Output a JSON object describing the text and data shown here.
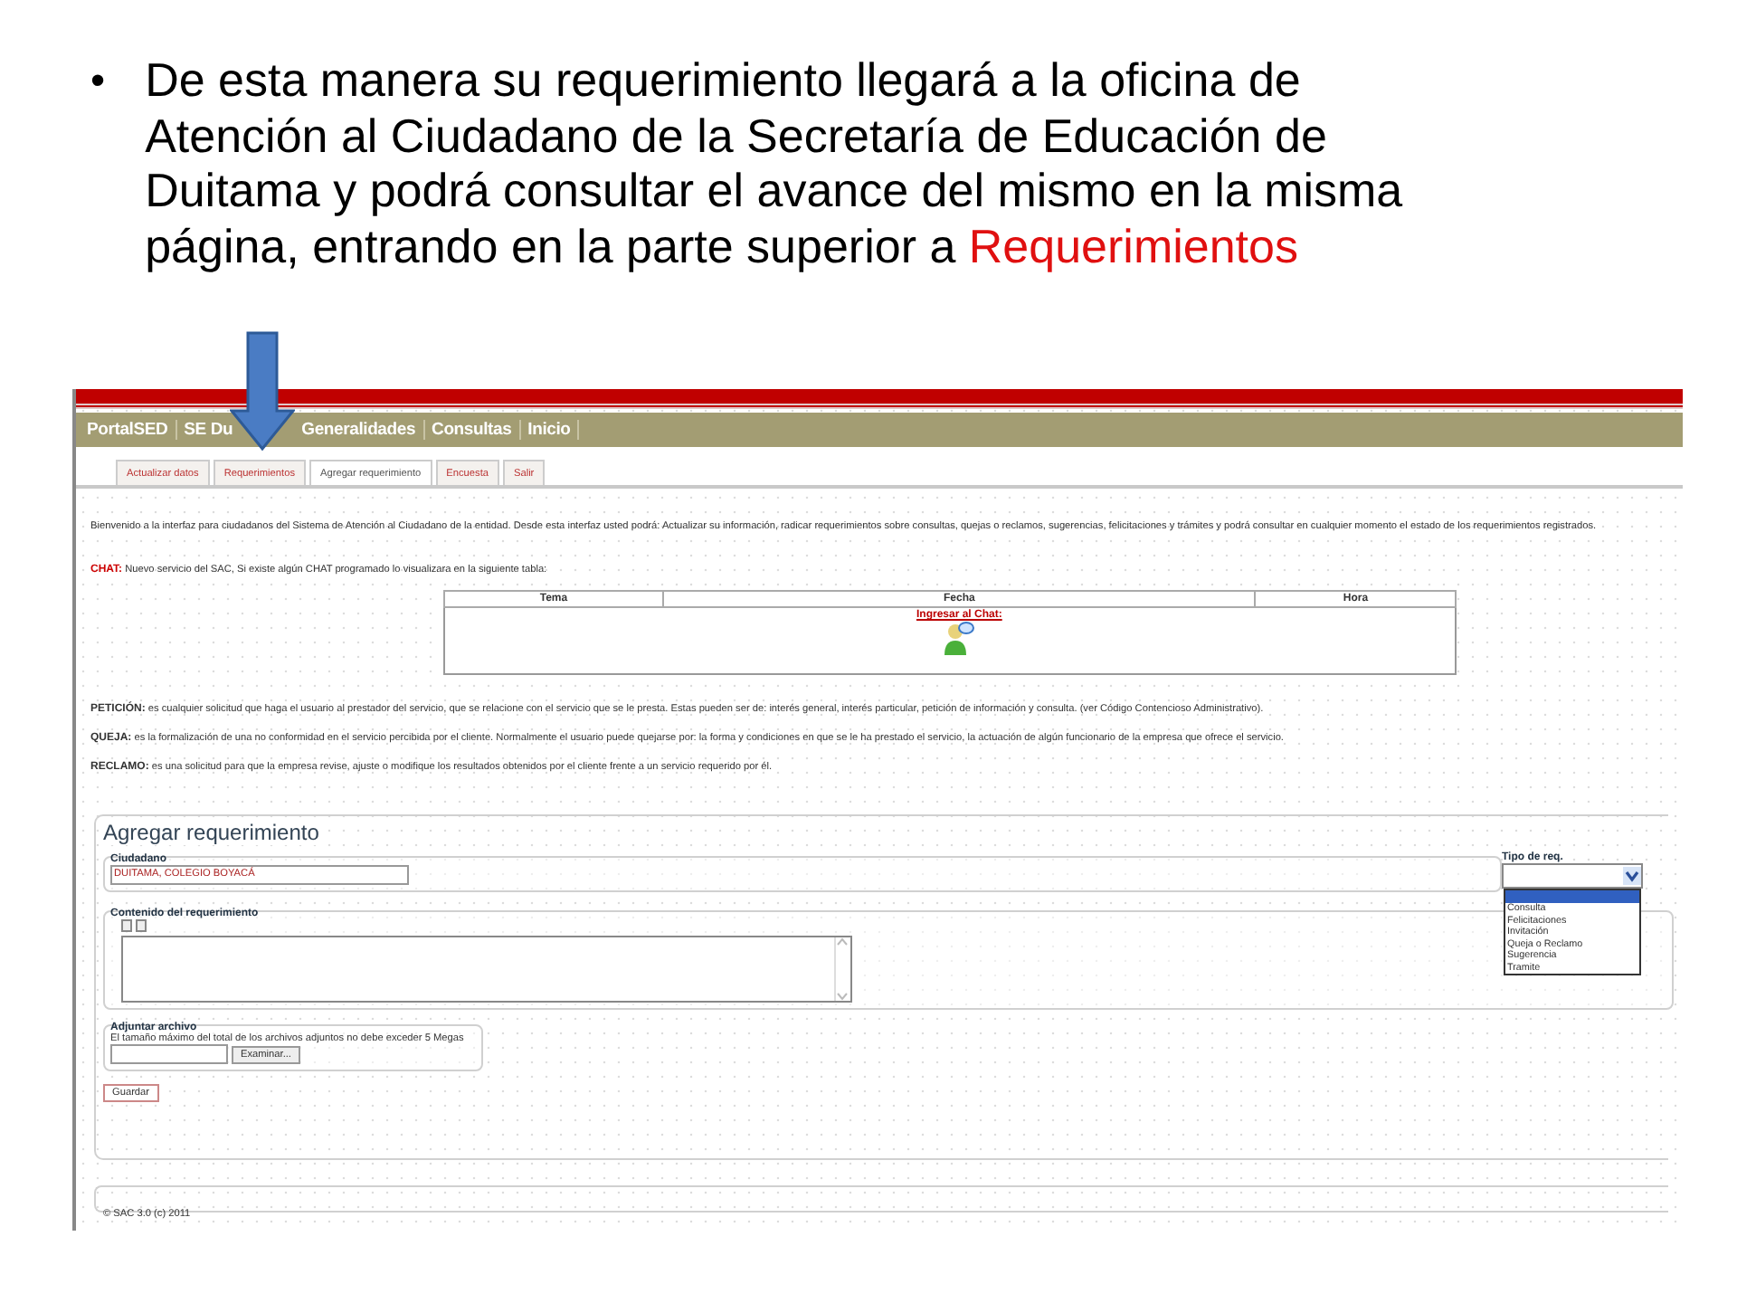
{
  "slide": {
    "bullet": "•",
    "text_parts": [
      {
        "text": "De esta manera su requerimiento llegará a la oficina de Atención al Ciudadano de la Secretaría de Educación de Duitama y podrá consultar el avance del mismo en la misma página, entrando en la parte superior a ",
        "highlight": false
      },
      {
        "text": "Requerimientos",
        "highlight": true
      }
    ]
  },
  "screen": {
    "top_menu": [
      {
        "label": "PortalSED",
        "covered": false
      },
      {
        "label": "SE Du",
        "covered": true
      },
      {
        "label": "Generalidades",
        "covered": false
      },
      {
        "label": "Consultas",
        "covered": false
      },
      {
        "label": "Inicio",
        "covered": false
      }
    ],
    "tabs": [
      {
        "label": "Actualizar datos",
        "selected": false
      },
      {
        "label": "Requerimientos",
        "selected": false
      },
      {
        "label": "Agregar requerimiento",
        "selected": true
      },
      {
        "label": "Encuesta",
        "selected": false
      },
      {
        "label": "Salir",
        "selected": false
      }
    ],
    "intro": "Bienvenido a la interfaz para ciudadanos del Sistema de Atención al Ciudadano de la entidad. Desde esta interfaz usted podrá: Actualizar su información, radicar requerimientos sobre consultas, quejas o reclamos, sugerencias, felicitaciones y trámites y podrá consultar en cualquier momento el estado de los requerimientos registrados.",
    "chat": {
      "label": "CHAT:",
      "text": "Nuevo servicio del SAC, Si existe algún CHAT programado lo visualizara en la siguiente tabla:",
      "columns": [
        "Tema",
        "Fecha",
        "Hora"
      ],
      "link": "Ingresar al Chat:"
    },
    "definitions": [
      {
        "term": "PETICIÓN:",
        "text": "es cualquier solicitud que haga el usuario al prestador del servicio, que se relacione con el servicio que se le presta. Estas pueden ser de: interés general, interés particular, petición de información y consulta. (ver Código Contencioso Administrativo)."
      },
      {
        "term": "QUEJA:",
        "text": "es la formalización de una no conformidad en el servicio percibida por el cliente. Normalmente el usuario puede quejarse por: la forma y condiciones en que se le ha prestado el servicio, la actuación de algún funcionario de la empresa que ofrece el servicio."
      },
      {
        "term": "RECLAMO:",
        "text": "es una solicitud para que la empresa revise, ajuste o modifique los resultados obtenidos por el cliente frente a un servicio requerido por él."
      }
    ],
    "form": {
      "title": "Agregar requerimiento",
      "ciudadano": {
        "legend": "Ciudadano",
        "value": "DUITAMA, COLEGIO BOYACÁ"
      },
      "tipo": {
        "legend": "Tipo de req.",
        "expanded": true,
        "options": [
          "Consulta",
          "Felicitaciones",
          "Invitación",
          "Queja o Reclamo",
          "Sugerencia",
          "Tramite"
        ]
      },
      "contenido": {
        "legend": "Contenido del requerimiento"
      },
      "adjuntar": {
        "legend": "Adjuntar archivo",
        "note": "El tamaño máximo del total de los archivos adjuntos no debe exceder 5 Megas",
        "button": "Examinar..."
      },
      "save": "Guardar"
    },
    "footer": "© SAC 3.0 (c) 2011"
  }
}
